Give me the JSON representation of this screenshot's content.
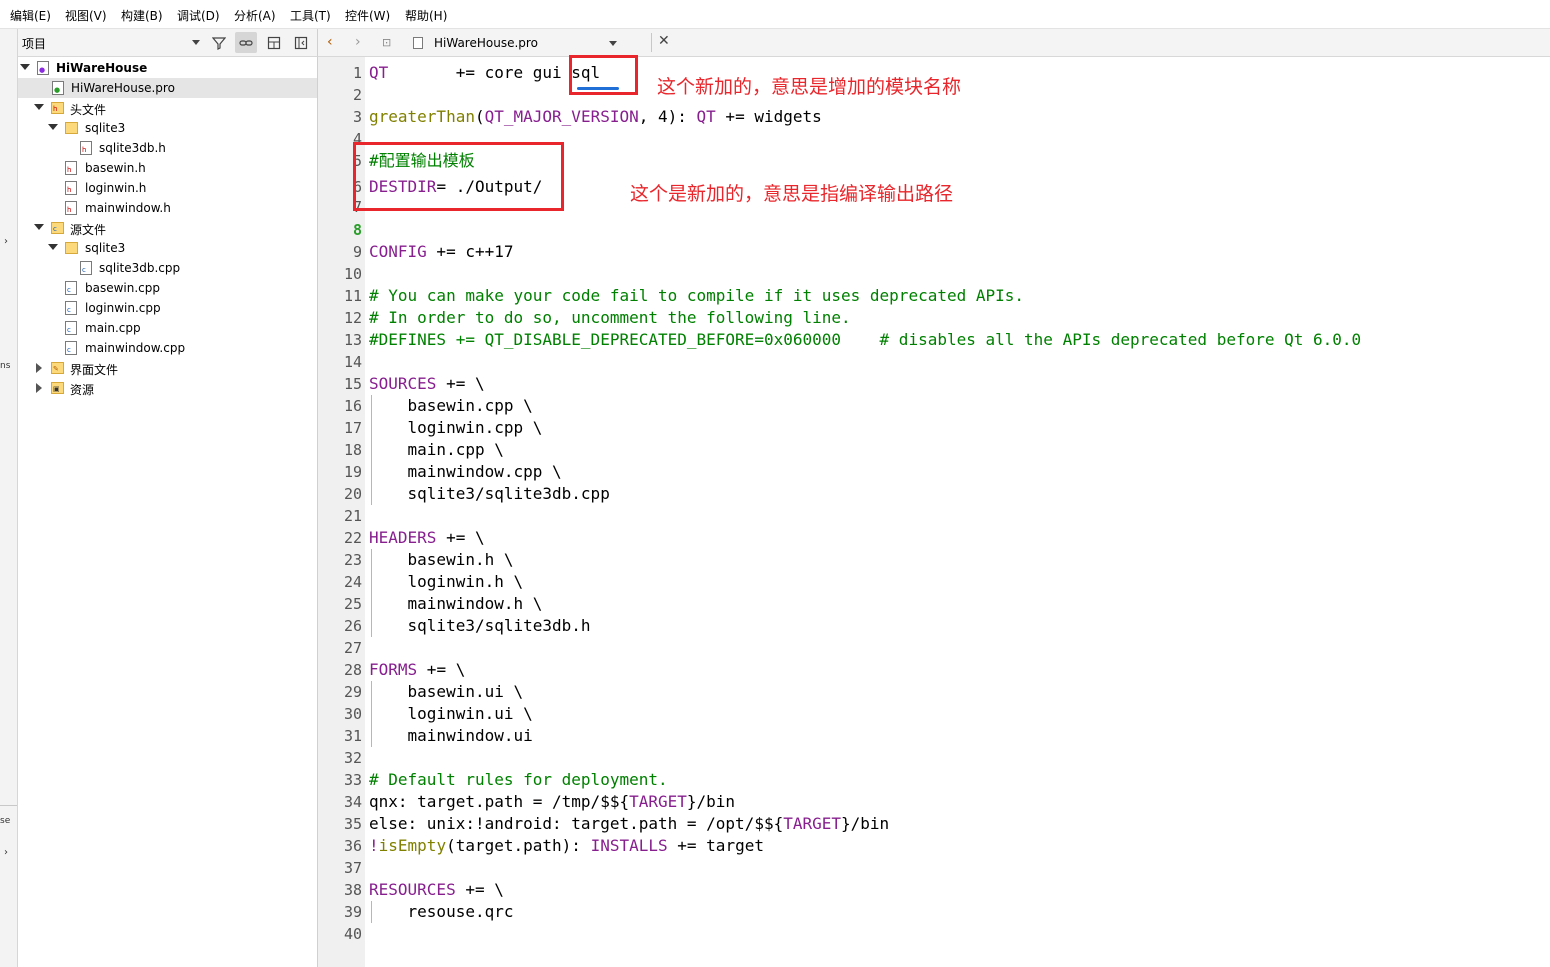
{
  "menubar": {
    "items": [
      "编辑(E)",
      "视图(V)",
      "构建(B)",
      "调试(D)",
      "分析(A)",
      "工具(T)",
      "控件(W)",
      "帮助(H)"
    ]
  },
  "left_strip": {
    "fragments": [
      "ns",
      "se"
    ]
  },
  "project_panel": {
    "view_selector": "项目",
    "tree": [
      {
        "label": "HiWareHouse",
        "icon": "qt-project-icon",
        "expanded": true
      },
      {
        "label": "HiWareHouse.pro",
        "icon": "pro-file-icon",
        "selected": true
      },
      {
        "label": "头文件",
        "icon": "header-folder-icon",
        "expanded": true
      },
      {
        "label": "sqlite3",
        "icon": "folder-icon",
        "expanded": true
      },
      {
        "label": "sqlite3db.h",
        "icon": "header-file-icon"
      },
      {
        "label": "basewin.h",
        "icon": "header-file-icon"
      },
      {
        "label": "loginwin.h",
        "icon": "header-file-icon"
      },
      {
        "label": "mainwindow.h",
        "icon": "header-file-icon"
      },
      {
        "label": "源文件",
        "icon": "source-folder-icon",
        "expanded": true
      },
      {
        "label": "sqlite3",
        "icon": "folder-icon",
        "expanded": true
      },
      {
        "label": "sqlite3db.cpp",
        "icon": "cpp-file-icon"
      },
      {
        "label": "basewin.cpp",
        "icon": "cpp-file-icon"
      },
      {
        "label": "loginwin.cpp",
        "icon": "cpp-file-icon"
      },
      {
        "label": "main.cpp",
        "icon": "cpp-file-icon"
      },
      {
        "label": "mainwindow.cpp",
        "icon": "cpp-file-icon"
      },
      {
        "label": "界面文件",
        "icon": "forms-folder-icon",
        "expanded": false
      },
      {
        "label": "资源",
        "icon": "resources-folder-icon",
        "expanded": false
      }
    ]
  },
  "editor": {
    "file_name": "HiWareHouse.pro",
    "current_line": 8,
    "lines": [
      "QT       += core gui sql",
      "",
      "greaterThan(QT_MAJOR_VERSION, 4): QT += widgets",
      "",
      "#配置输出模板",
      "DESTDIR= ./Output/",
      "",
      "",
      "CONFIG += c++17",
      "",
      "# You can make your code fail to compile if it uses deprecated APIs.",
      "# In order to do so, uncomment the following line.",
      "#DEFINES += QT_DISABLE_DEPRECATED_BEFORE=0x060000    # disables all the APIs deprecated before Qt 6.0.0",
      "",
      "SOURCES += \\",
      "    basewin.cpp \\",
      "    loginwin.cpp \\",
      "    main.cpp \\",
      "    mainwindow.cpp \\",
      "    sqlite3/sqlite3db.cpp",
      "",
      "HEADERS += \\",
      "    basewin.h \\",
      "    loginwin.h \\",
      "    mainwindow.h \\",
      "    sqlite3/sqlite3db.h",
      "",
      "FORMS += \\",
      "    basewin.ui \\",
      "    loginwin.ui \\",
      "    mainwindow.ui",
      "",
      "# Default rules for deployment.",
      "qnx: target.path = /tmp/$${TARGET}/bin",
      "else: unix:!android: target.path = /opt/$${TARGET}/bin",
      "!isEmpty(target.path): INSTALLS += target",
      "",
      "RESOURCES += \\",
      "    resouse.qrc",
      ""
    ]
  },
  "annotations": {
    "sql_note": "这个新加的，意思是增加的模块名称",
    "destdir_note": "这个是新加的，意思是指编译输出路径"
  },
  "colors": {
    "annotation_red": "#e8262b",
    "keyword": "#871f8f",
    "function": "#808000",
    "comment": "#008000",
    "current_line_number": "#2a9d2a",
    "spellcheck_underline": "#1f6fd6"
  }
}
